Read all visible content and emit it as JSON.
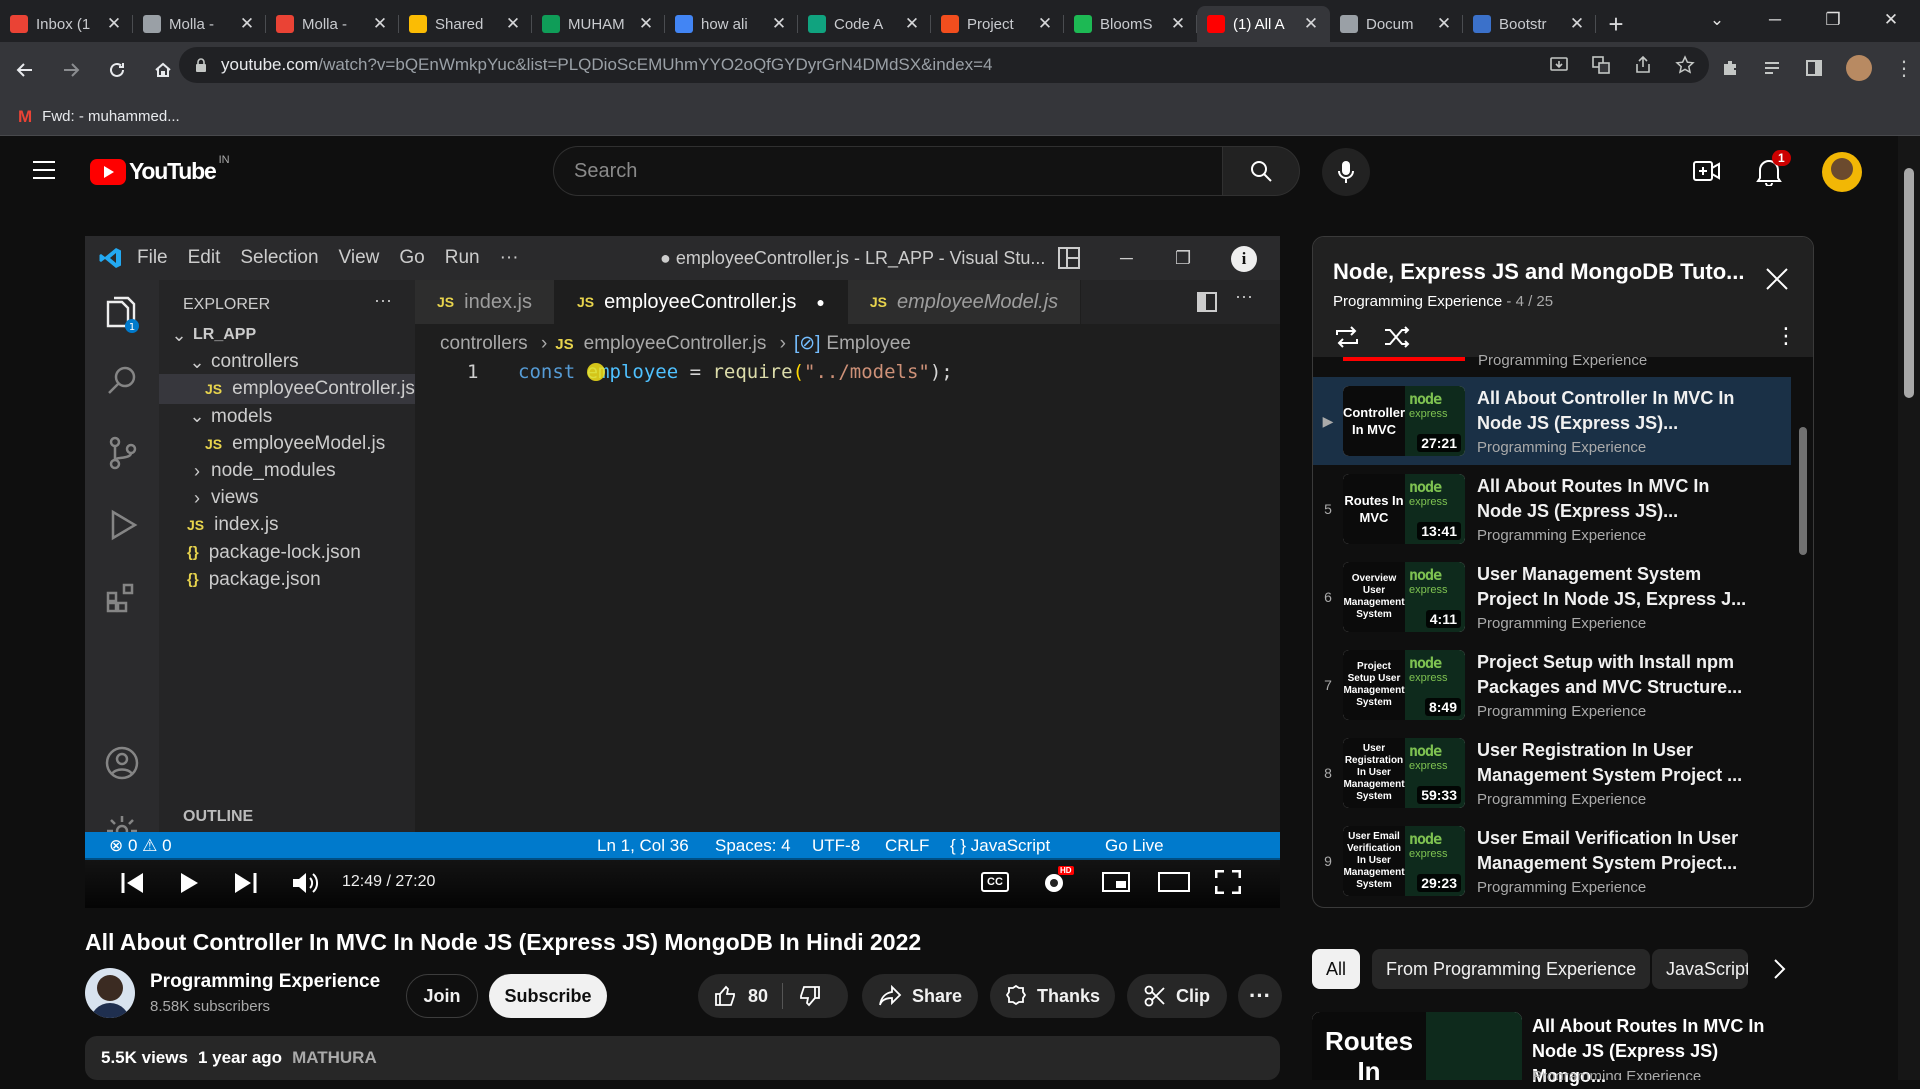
{
  "browser": {
    "tabs": [
      {
        "label": "Inbox (1",
        "favicon": "gmail-icon",
        "color": "#ea4335"
      },
      {
        "label": "Molla -",
        "favicon": "globe-icon",
        "color": "#9aa0a6"
      },
      {
        "label": "Molla -",
        "favicon": "gmail-icon",
        "color": "#ea4335"
      },
      {
        "label": "Shared",
        "favicon": "drive-icon",
        "color": "#fbbc04"
      },
      {
        "label": "MUHAM",
        "favicon": "sheets-icon",
        "color": "#0f9d58"
      },
      {
        "label": "how ali",
        "favicon": "google-icon",
        "color": "#4285f4"
      },
      {
        "label": "Code A",
        "favicon": "chatgpt-icon",
        "color": "#10a37f"
      },
      {
        "label": "Project",
        "favicon": "figma-icon",
        "color": "#f24e1e"
      },
      {
        "label": "BloomS",
        "favicon": "bloom-icon",
        "color": "#1db954"
      },
      {
        "label": "(1) All A",
        "favicon": "youtube-icon",
        "color": "#ff0000",
        "active": true
      },
      {
        "label": "Docum",
        "favicon": "globe-icon",
        "color": "#9aa0a6"
      },
      {
        "label": "Bootstr",
        "favicon": "mdb-icon",
        "color": "#3b71ca"
      }
    ],
    "url_host": "youtube.com",
    "url_rest": "/watch?v=bQEnWmkpYuc&list=PLQDioScEMUhmYYO2oQfGYDyrGrN4DMdSX&index=4",
    "bookmark": "Fwd: - muhammed..."
  },
  "youtube": {
    "logo_text": "YouTube",
    "region": "IN",
    "search_placeholder": "Search",
    "notif_count": "1"
  },
  "player": {
    "vscode": {
      "menu": [
        "File",
        "Edit",
        "Selection",
        "View",
        "Go",
        "Run",
        "···"
      ],
      "window_title": "● employeeController.js - LR_APP - Visual Stu...",
      "explorer_label": "EXPLORER",
      "tree": [
        {
          "label": "LR_APP",
          "kind": "folder-open",
          "indent": 0,
          "bold": true
        },
        {
          "label": "controllers",
          "kind": "folder-open",
          "indent": 1
        },
        {
          "label": "employeeController.js",
          "kind": "js",
          "indent": 2,
          "selected": true
        },
        {
          "label": "models",
          "kind": "folder-open",
          "indent": 1
        },
        {
          "label": "employeeModel.js",
          "kind": "js",
          "indent": 2
        },
        {
          "label": "node_modules",
          "kind": "folder",
          "indent": 1
        },
        {
          "label": "views",
          "kind": "folder",
          "indent": 1
        },
        {
          "label": "index.js",
          "kind": "js",
          "indent": 1
        },
        {
          "label": "package-lock.json",
          "kind": "json",
          "indent": 1
        },
        {
          "label": "package.json",
          "kind": "json",
          "indent": 1
        }
      ],
      "outline_label": "OUTLINE",
      "editor_tabs": [
        {
          "label": "index.js",
          "active": false
        },
        {
          "label": "employeeController.js",
          "active": true
        },
        {
          "label": "employeeModel.js",
          "active": false
        }
      ],
      "breadcrumb": [
        "controllers",
        "employeeController.js",
        "Employee"
      ],
      "line_number": "1",
      "code": {
        "kw": "const ",
        "ident": "employee",
        "op": " = ",
        "fn": "require",
        "str": "\"../models\"",
        "end": ");"
      },
      "status": {
        "problems": "⊗ 0 ⚠ 0",
        "cursor": "Ln 1, Col 36",
        "spaces": "Spaces: 4",
        "encoding": "UTF-8",
        "eol": "CRLF",
        "language": "{ }  JavaScript",
        "golive": "Go Live"
      }
    },
    "time": "12:49 / 27:20",
    "progress_fraction": 0.47
  },
  "video": {
    "title": "All About Controller In MVC In Node JS (Express JS) MongoDB In Hindi 2022",
    "channel": "Programming Experience",
    "subscribers": "8.58K subscribers",
    "join": "Join",
    "subscribe": "Subscribe",
    "likes": "80",
    "share": "Share",
    "thanks": "Thanks",
    "clip": "Clip",
    "views": "5.5K views",
    "age": "1 year ago",
    "tag": "MATHURA"
  },
  "playlist": {
    "title": "Node, Express JS and MongoDB Tuto...",
    "channel": "Programming Experience",
    "position": "- 4 / 25",
    "partial_channel": "Programming Experience",
    "items": [
      {
        "index": "▶",
        "thumb": "Controller In MVC",
        "title": "All About Controller In MVC In Node JS (Express JS)...",
        "channel": "Programming Experience",
        "duration": "27:21",
        "current": true
      },
      {
        "index": "5",
        "thumb": "Routes In MVC",
        "title": "All About Routes In MVC In Node JS (Express JS)...",
        "channel": "Programming Experience",
        "duration": "13:41"
      },
      {
        "index": "6",
        "thumb": "Overview User Management System",
        "title": "User Management System Project In Node JS, Express J...",
        "channel": "Programming Experience",
        "duration": "4:11"
      },
      {
        "index": "7",
        "thumb": "Project Setup User Management System",
        "title": "Project Setup with Install npm Packages and MVC Structure...",
        "channel": "Programming Experience",
        "duration": "8:49"
      },
      {
        "index": "8",
        "thumb": "User Registration In User Management System",
        "title": "User Registration In User Management System Project ...",
        "channel": "Programming Experience",
        "duration": "59:33"
      },
      {
        "index": "9",
        "thumb": "User Email Verification In User Management System",
        "title": "User Email Verification In User Management System Project...",
        "channel": "Programming Experience",
        "duration": "29:23"
      }
    ]
  },
  "chips": [
    "All",
    "From Programming Experience",
    "JavaScript"
  ],
  "recommended": {
    "thumb": "Routes In",
    "title": "All About Routes In MVC In Node JS (Express JS) Mongo...",
    "channel": "Programming Experience"
  }
}
